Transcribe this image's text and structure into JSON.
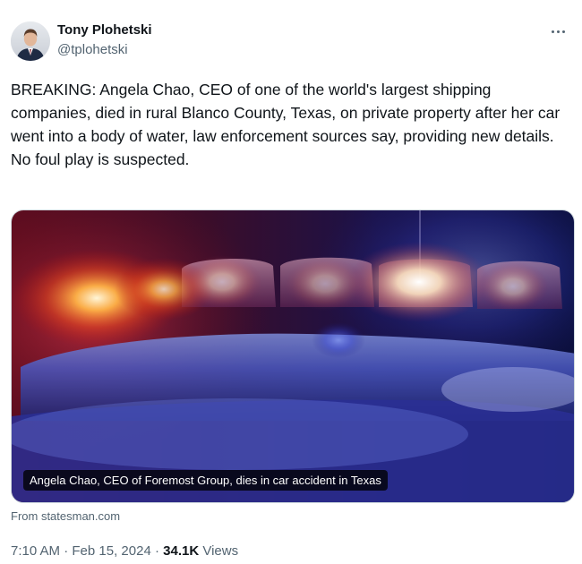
{
  "author": {
    "display_name": "Tony Plohetski",
    "handle": "@tplohetski",
    "avatar_icon": "user-avatar-photo"
  },
  "more_icon": "more-horizontal-icon",
  "tweet": {
    "text": "BREAKING: Angela Chao, CEO of one of the world's largest shipping companies, died in rural Blanco County, Texas, on private property after her car went into a body of water, law enforcement sources say, providing new details.\nNo foul play is suspected."
  },
  "media": {
    "caption": "Angela Chao, CEO of Foremost Group, dies in car accident in Texas",
    "source": "From statesman.com"
  },
  "meta": {
    "time": "7:10 AM",
    "separator": "·",
    "date": "Feb 15, 2024",
    "views_count": "34.1K",
    "views_label": "Views"
  },
  "colors": {
    "text_primary": "#0f1419",
    "text_secondary": "#536471",
    "border": "#cfd9de"
  }
}
